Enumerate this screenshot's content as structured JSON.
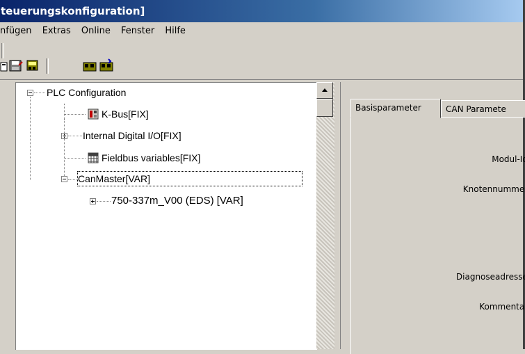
{
  "window": {
    "title": "teuerungskonfiguration]"
  },
  "menu": [
    "nfügen",
    "Extras",
    "Online",
    "Fenster",
    "Hilfe"
  ],
  "tree": {
    "root": "PLC Configuration",
    "kbus": "K-Bus[FIX]",
    "internal": "Internal Digital I/O[FIX]",
    "fieldbus": "Fieldbus variables[FIX]",
    "canmaster": "CanMaster[VAR]",
    "module": "750-337m_V00 (EDS)  [VAR]"
  },
  "tabs": {
    "basis": "Basisparameter",
    "can": "CAN Paramete"
  },
  "params": {
    "modul_id": "Modul-Id:",
    "knoten": "Knotennummer:",
    "diagnose": "Diagnoseadresse:",
    "kommentar": "Kommentar:"
  },
  "colors": {
    "titlebar_start": "#0a246a",
    "titlebar_end": "#a6caf0",
    "face": "#d4d0c8"
  }
}
